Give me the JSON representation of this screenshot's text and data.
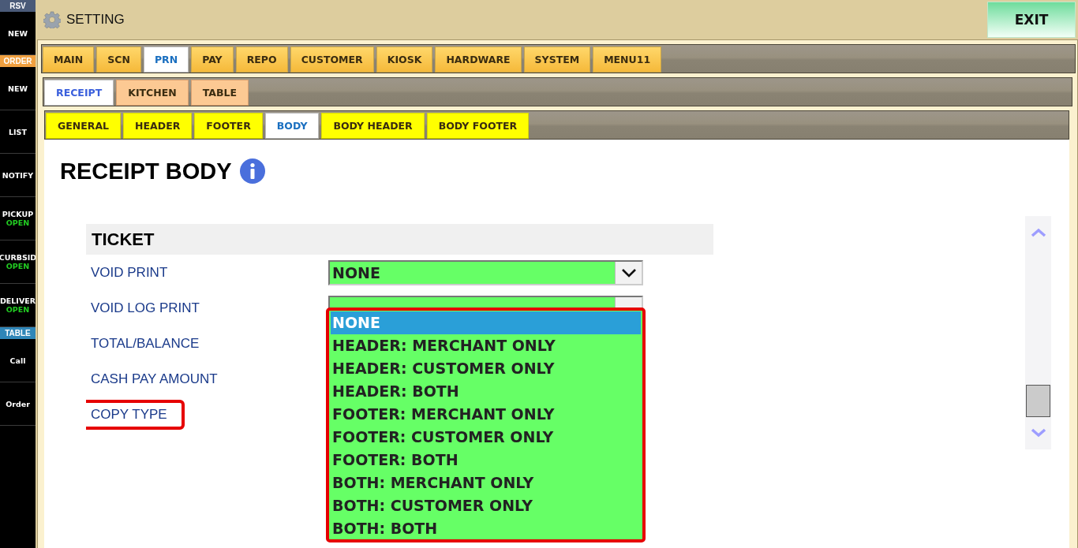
{
  "sidebar": [
    {
      "kind": "header",
      "label": "RSV",
      "color": "#4a5a78"
    },
    {
      "kind": "button",
      "label": "NEW"
    },
    {
      "kind": "header",
      "label": "ORDER",
      "color": "#f0a040"
    },
    {
      "kind": "button",
      "label": "NEW"
    },
    {
      "kind": "button",
      "label": "LIST"
    },
    {
      "kind": "button",
      "label": "NOTIFY"
    },
    {
      "kind": "button",
      "label": "PICKUP",
      "status": "OPEN"
    },
    {
      "kind": "button",
      "label": "CURBSID",
      "status": "OPEN"
    },
    {
      "kind": "button",
      "label": "DELIVER",
      "status": "OPEN"
    },
    {
      "kind": "header",
      "label": "TABLE",
      "color": "#2f86b8"
    },
    {
      "kind": "button",
      "label": "Call"
    },
    {
      "kind": "button",
      "label": "Order"
    }
  ],
  "header": {
    "title": "SETTING",
    "exit_button": "EXIT"
  },
  "tabs": [
    {
      "label": "MAIN",
      "selected": false
    },
    {
      "label": "SCN",
      "selected": false
    },
    {
      "label": "PRN",
      "selected": true
    },
    {
      "label": "PAY",
      "selected": false
    },
    {
      "label": "REPO",
      "selected": false
    },
    {
      "label": "CUSTOMER",
      "selected": false
    },
    {
      "label": "KIOSK",
      "selected": false
    },
    {
      "label": "HARDWARE",
      "selected": false
    },
    {
      "label": "SYSTEM",
      "selected": false
    },
    {
      "label": "MENU11",
      "selected": false
    }
  ],
  "sub_tabs": [
    {
      "label": "RECEIPT",
      "selected": true
    },
    {
      "label": "KITCHEN",
      "selected": false
    },
    {
      "label": "TABLE",
      "selected": false
    }
  ],
  "section_tabs": [
    {
      "label": "GENERAL",
      "selected": false
    },
    {
      "label": "HEADER",
      "selected": false
    },
    {
      "label": "FOOTER",
      "selected": false
    },
    {
      "label": "BODY",
      "selected": true
    },
    {
      "label": "BODY HEADER",
      "selected": false
    },
    {
      "label": "BODY FOOTER",
      "selected": false
    }
  ],
  "page_title": "RECEIPT BODY",
  "group": {
    "title": "TICKET",
    "rows": [
      {
        "label": "VOID PRINT",
        "kind": "dropdown",
        "value": "NONE",
        "highlighted": false
      },
      {
        "label": "VOID LOG PRINT",
        "kind": "dropdown",
        "highlighted": false
      },
      {
        "label": "TOTAL/BALANCE",
        "highlighted": false
      },
      {
        "label": "CASH PAY AMOUNT",
        "highlighted": false
      },
      {
        "label": "COPY TYPE",
        "highlighted": true
      }
    ]
  },
  "dropdown_list": {
    "highlighted": true,
    "options": [
      {
        "label": "NONE",
        "selected": true
      },
      {
        "label": "HEADER: MERCHANT ONLY",
        "selected": false
      },
      {
        "label": "HEADER: CUSTOMER ONLY",
        "selected": false
      },
      {
        "label": "HEADER: BOTH",
        "selected": false
      },
      {
        "label": "FOOTER: MERCHANT ONLY",
        "selected": false
      },
      {
        "label": "FOOTER: CUSTOMER ONLY",
        "selected": false
      },
      {
        "label": "FOOTER: BOTH",
        "selected": false
      },
      {
        "label": "BOTH: MERCHANT ONLY",
        "selected": false
      },
      {
        "label": "BOTH: CUSTOMER ONLY",
        "selected": false
      },
      {
        "label": "BOTH: BOTH",
        "selected": false
      }
    ]
  }
}
